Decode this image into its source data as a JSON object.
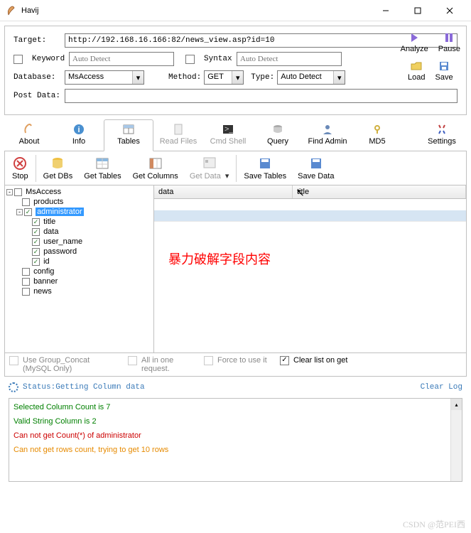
{
  "window": {
    "title": "Havij"
  },
  "form": {
    "target_label": "Target:",
    "target_value": "http://192.168.16.166:82/news_view.asp?id=10",
    "keyword_label": "Keyword",
    "keyword_placeholder": "Auto Detect",
    "syntax_label": "Syntax",
    "syntax_placeholder": "Auto Detect",
    "database_label": "Database:",
    "database_value": "MsAccess",
    "method_label": "Method:",
    "method_value": "GET",
    "type_label": "Type:",
    "type_value": "Auto Detect",
    "postdata_label": "Post Data:",
    "postdata_value": ""
  },
  "side": {
    "analyze": "Analyze",
    "pause": "Pause",
    "load": "Load",
    "save": "Save"
  },
  "tabs": {
    "about": "About",
    "info": "Info",
    "tables": "Tables",
    "readfiles": "Read Files",
    "cmdshell": "Cmd Shell",
    "query": "Query",
    "findadmin": "Find Admin",
    "md5": "MD5",
    "settings": "Settings"
  },
  "toolbar": {
    "stop": "Stop",
    "getdbs": "Get DBs",
    "gettables": "Get Tables",
    "getcolumns": "Get Columns",
    "getdata": "Get Data",
    "savetables": "Save Tables",
    "savedata": "Save Data"
  },
  "tree": {
    "root": "MsAccess",
    "products": "products",
    "administrator": "administrator",
    "cols": [
      "title",
      "data",
      "user_name",
      "password",
      "id"
    ],
    "config": "config",
    "banner": "banner",
    "news": "news"
  },
  "grid": {
    "col1": "data",
    "col2": "title"
  },
  "annotation": "暴力破解字段内容",
  "options": {
    "group_concat": "Use Group_Concat (MySQL Only)",
    "all_one": "All in one request.",
    "force": "Force to use it",
    "clearlist": "Clear list on get"
  },
  "status": {
    "label": "Status:",
    "text": "Getting Column data",
    "clear": "Clear Log"
  },
  "log": [
    {
      "text": "Selected Column Count is 7",
      "color": "#008000"
    },
    {
      "text": "Valid String Column is 2",
      "color": "#008000"
    },
    {
      "text": "Can not get Count(*) of administrator",
      "color": "#cc0000"
    },
    {
      "text": "Can not get rows count, trying to get 10 rows",
      "color": "#e68a00"
    }
  ],
  "watermark": "CSDN @范PEI西"
}
